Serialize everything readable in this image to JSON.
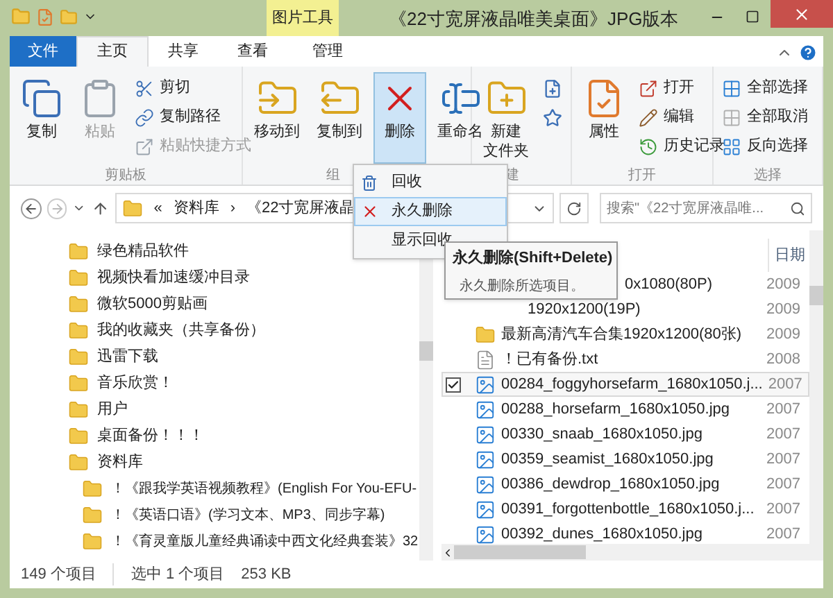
{
  "window": {
    "title": "《22寸宽屏液晶唯美桌面》JPG版本",
    "context_tab": "图片工具"
  },
  "tabs": [
    {
      "label": "文件",
      "kind": "file",
      "selected": false
    },
    {
      "label": "主页",
      "kind": "normal",
      "selected": true
    },
    {
      "label": "共享",
      "kind": "normal",
      "selected": false
    },
    {
      "label": "查看",
      "kind": "normal",
      "selected": false
    },
    {
      "label": "管理",
      "kind": "normal",
      "selected": false
    }
  ],
  "ribbon": {
    "groups": [
      {
        "label": "剪贴板",
        "large": [
          {
            "lines": [
              "复制"
            ],
            "disabled": false,
            "pressed": false
          },
          {
            "lines": [
              "粘贴"
            ],
            "disabled": true,
            "pressed": false
          }
        ],
        "small": [
          {
            "label": "剪切",
            "disabled": false
          },
          {
            "label": "复制路径",
            "disabled": false
          },
          {
            "label": "粘贴快捷方式",
            "disabled": true
          }
        ]
      },
      {
        "label": "组",
        "large": [
          {
            "lines": [
              "移动到"
            ],
            "disabled": false,
            "pressed": false
          },
          {
            "lines": [
              "复制到"
            ],
            "disabled": false,
            "pressed": false
          },
          {
            "lines": [
              "删除"
            ],
            "disabled": false,
            "pressed": true
          },
          {
            "lines": [
              "重命名"
            ],
            "disabled": false,
            "pressed": false
          }
        ]
      },
      {
        "label": "建",
        "large": [
          {
            "lines": [
              "新建",
              "文件夹"
            ],
            "disabled": false,
            "pressed": false
          }
        ]
      },
      {
        "label": "打开",
        "large": [
          {
            "lines": [
              "属性"
            ],
            "disabled": false,
            "pressed": false
          }
        ],
        "small": [
          {
            "label": "打开",
            "disabled": false
          },
          {
            "label": "编辑",
            "disabled": false
          },
          {
            "label": "历史记录",
            "disabled": false
          }
        ]
      },
      {
        "label": "选择",
        "small": [
          {
            "label": "全部选择",
            "disabled": false
          },
          {
            "label": "全部取消",
            "disabled": false
          },
          {
            "label": "反向选择",
            "disabled": false
          }
        ]
      }
    ]
  },
  "delete_menu": [
    {
      "label": "回收",
      "selected": false
    },
    {
      "label": "永久删除",
      "selected": true
    },
    {
      "label": "显示回收",
      "selected": false
    }
  ],
  "tooltip": {
    "title": "永久删除(Shift+Delete)",
    "text": "永久删除所选项目。"
  },
  "address": {
    "overflow": "«",
    "separator": "›",
    "crumbs": [
      "资料库",
      "《22寸宽屏液晶"
    ]
  },
  "search": {
    "placeholder": "搜索\"《22寸宽屏液晶唯..."
  },
  "tree": [
    {
      "label": "绿色精品软件"
    },
    {
      "label": "视频快看加速缓冲目录"
    },
    {
      "label": "微软5000剪贴画"
    },
    {
      "label": "我的收藏夹（共享备份）"
    },
    {
      "label": "迅雷下载"
    },
    {
      "label": "音乐欣赏！"
    },
    {
      "label": "用户"
    },
    {
      "label": "桌面备份！！！"
    },
    {
      "label": "资料库",
      "children": [
        {
          "label": "！《跟我学英语视频教程》(English For You-EFU-"
        },
        {
          "label": "！《英语口语》(学习文本、MP3、同步字幕)"
        },
        {
          "label": "！《育灵童版儿童经典诵读中西文化经典套装》32"
        }
      ]
    }
  ],
  "files": {
    "columns": [
      "日期"
    ],
    "rows": [
      {
        "name": "0x1080(80P)",
        "kind": "partial",
        "date": "2009",
        "selected": false
      },
      {
        "name": "1920x1200(19P)",
        "kind": "partial",
        "date": "2009",
        "selected": false
      },
      {
        "name": "最新高清汽车合集1920x1200(80张)",
        "kind": "folder",
        "date": "2009",
        "selected": false
      },
      {
        "name": "！已有备份.txt",
        "kind": "txt",
        "date": "2008",
        "selected": false
      },
      {
        "name": "00284_foggyhorsefarm_1680x1050.j...",
        "kind": "jpg",
        "date": "2007",
        "selected": true
      },
      {
        "name": "00288_horsefarm_1680x1050.jpg",
        "kind": "jpg",
        "date": "2007",
        "selected": false
      },
      {
        "name": "00330_snaab_1680x1050.jpg",
        "kind": "jpg",
        "date": "2007",
        "selected": false
      },
      {
        "name": "00359_seamist_1680x1050.jpg",
        "kind": "jpg",
        "date": "2007",
        "selected": false
      },
      {
        "name": "00386_dewdrop_1680x1050.jpg",
        "kind": "jpg",
        "date": "2007",
        "selected": false
      },
      {
        "name": "00391_forgottenbottle_1680x1050.j...",
        "kind": "jpg",
        "date": "2007",
        "selected": false
      },
      {
        "name": "00392_dunes_1680x1050.jpg",
        "kind": "jpg",
        "date": "2007",
        "selected": false
      }
    ]
  },
  "status_bar": {
    "count": "149 个项目",
    "selection": "选中 1 个项目",
    "size": "253 KB"
  }
}
